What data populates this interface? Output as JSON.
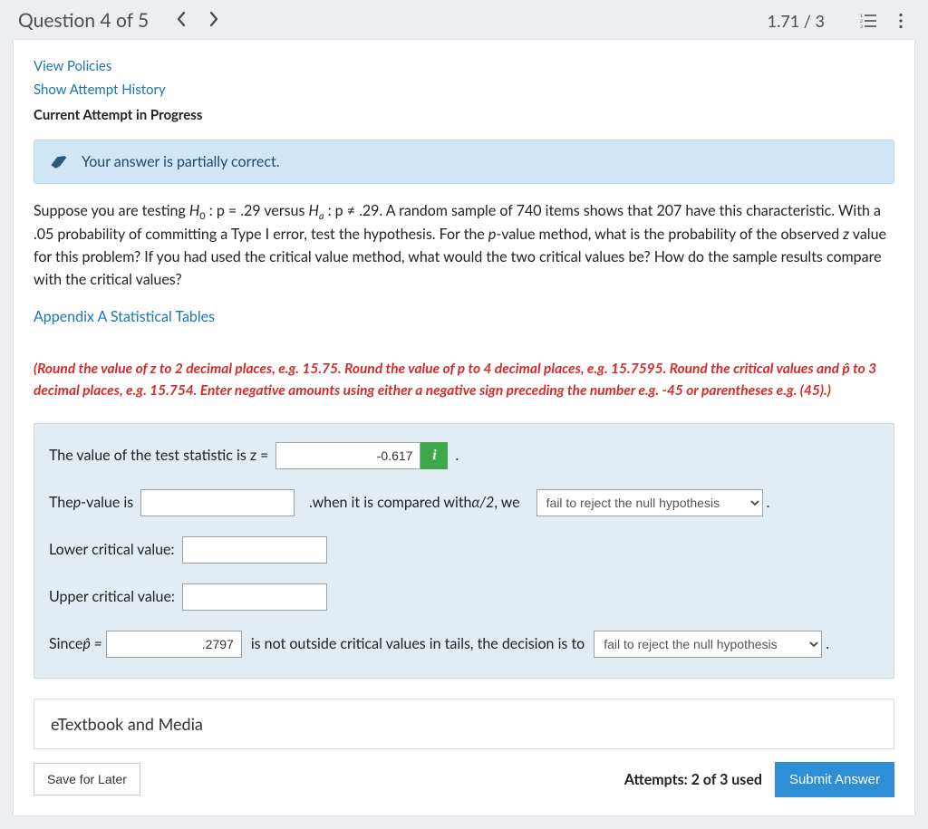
{
  "header": {
    "title": "Question 4 of 5",
    "score": "1.71 / 3"
  },
  "links": {
    "view_policies": "View Policies",
    "show_history": "Show Attempt History",
    "current_attempt": "Current Attempt in Progress",
    "appendix": "Appendix A Statistical Tables"
  },
  "feedback": {
    "message": "Your answer is partially correct."
  },
  "question": {
    "pre": "Suppose you are testing ",
    "h0_label": "H",
    "h0_sub": "0",
    "h0_rest": " : p  =  .29 versus ",
    "ha_label": "H",
    "ha_sub": "a",
    "ha_rest": " : p  ≠  .29. A random sample of 740 items shows that 207 have this characteristic. With a .05 probability of committing a Type I error, test the hypothesis. For the ",
    "pval_word": "p",
    "after_pval": "-value method, what is the probability of the observed ",
    "z_word": "z",
    "tail": " value for this problem? If you had used the critical value method, what would the two critical values be? How do the sample results compare with the critical values?"
  },
  "instructions": {
    "text_a": "(Round the value of z to 2 decimal places, e.g. 15.75. Round the value of p to 4 decimal places, e.g. 15.7595. Round the critical values and ",
    "phat": "p̂",
    "text_b": " to 3 decimal places, e.g. 15.754. Enter negative amounts using either a negative sign preceding the number e.g. -45 or parentheses e.g. (45).)"
  },
  "answers": {
    "line1_label": "The value of the test statistic is z =",
    "z_value": "-0.617",
    "dot": ".",
    "line2_pre": "The ",
    "line2_p": "p",
    "line2_post": "-value is",
    "line2_mid": ".when it is compared with ",
    "alpha_over_2": "α/2",
    "line2_we": ", we",
    "select1": "fail to reject the null hypothesis",
    "lower_label": "Lower critical value:",
    "upper_label": "Upper critical value:",
    "since_pre": "Since ",
    "phat_eq": "p̂ =",
    "phat_value": ".2797",
    "since_mid": "is not outside critical values in tails, the decision is to",
    "select2": "fail to reject the null hypothesis"
  },
  "footer": {
    "etext": "eTextbook and Media",
    "save": "Save for Later",
    "attempts": "Attempts: 2 of 3 used",
    "submit": "Submit Answer"
  }
}
